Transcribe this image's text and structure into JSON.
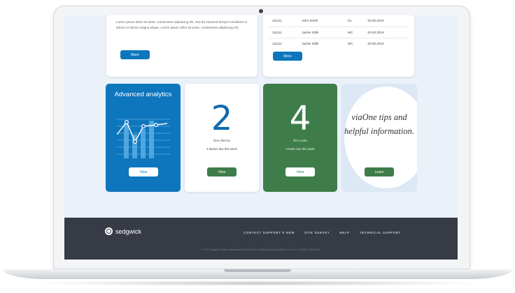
{
  "top_left_card": {
    "body": "Lorem ipsum dolor sit amet, consectetur adipiscing elit, sed do eiusmod tempor incididunt ut labore et dolore magna aliqua. Lorem ipsum dolor sit amet, consectetur adipiscing elit,.",
    "button_label": "More"
  },
  "top_right_card": {
    "rows": [
      [
        "111111",
        "John Smith",
        "GL",
        "00.00.2019"
      ],
      [
        "111111",
        "Jackie Stills",
        "WC",
        "00.00.2019"
      ],
      [
        "111111",
        "Jackie Stills",
        "WC",
        "00.00.2019"
      ]
    ],
    "button_label": "More"
  },
  "tiles": {
    "analytics": {
      "title": "Advanced analytics",
      "button_label": "View"
    },
    "diaries": {
      "number": "2",
      "subtitle": "New diaries",
      "note": "3 diaries due this week",
      "button_label": "View"
    },
    "tasks": {
      "number": "4",
      "subtitle": "New tasks",
      "note": "3 tasks due this week",
      "button_label": "View"
    },
    "tips": {
      "text": "viaOne tips and helpful information.",
      "button_label": "Learn"
    }
  },
  "footer": {
    "logo_text": "sedgwick",
    "links": [
      "CONTACT SUPPORT'S NEW",
      "SITE SURVEY",
      "HELP",
      "TECHNICAL SUPPORT"
    ],
    "copyright": "© 2021 Sedgwick Claims Management Services, Inc. All Rights Reserved. Build 3.x.x.x on 7.16.2021 1:00:00 PM"
  },
  "colors": {
    "brand_blue": "#0e76bd",
    "brand_green": "#3e7d4a",
    "footer_bg": "#363b45",
    "page_bg": "#eaf1f9"
  },
  "icons": [
    "analytics-chart-icon",
    "sedgwick-logo-icon"
  ]
}
